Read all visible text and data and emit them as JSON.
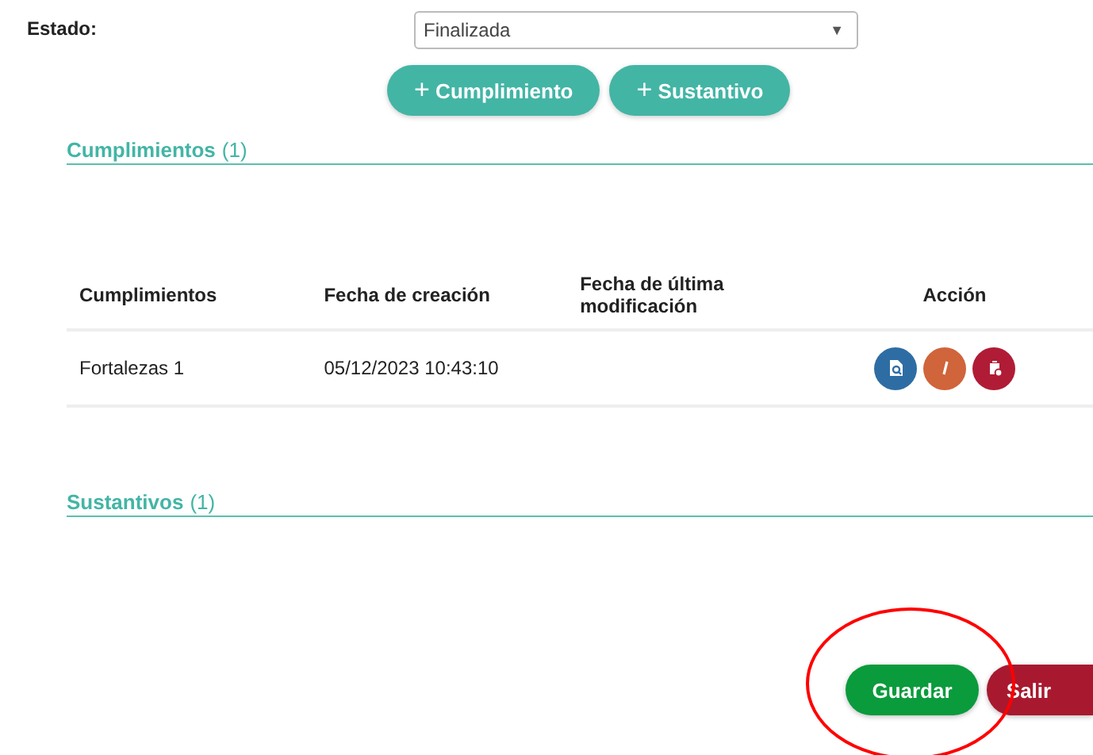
{
  "estado": {
    "label": "Estado:",
    "value": "Finalizada",
    "arrow": "▼"
  },
  "add_buttons": [
    {
      "icon": "+",
      "label": "Cumplimiento"
    },
    {
      "icon": "+",
      "label": "Sustantivo"
    }
  ],
  "cumplimientos": {
    "title": "Cumplimientos",
    "count": "(1)",
    "table": {
      "columns": [
        "Cumplimientos",
        "Fecha de creación",
        "Fecha de última modificación",
        "Acción"
      ],
      "rows": [
        {
          "cells": [
            "Fortalezas 1",
            "05/12/2023 10:43:10",
            ""
          ],
          "actions": [
            {
              "kind": "view",
              "color": "#2e6da4"
            },
            {
              "kind": "edit",
              "color": "#d0643a"
            },
            {
              "kind": "delete",
              "color": "#b01c35"
            }
          ]
        }
      ]
    }
  },
  "sustantivos": {
    "title": "Sustantivos",
    "count": "(1)"
  },
  "footer_buttons": [
    {
      "kind": "save",
      "label": "Guardar"
    },
    {
      "kind": "exit",
      "label": "Salir"
    }
  ],
  "annotations": [
    {
      "kind": "ellipse"
    }
  ]
}
